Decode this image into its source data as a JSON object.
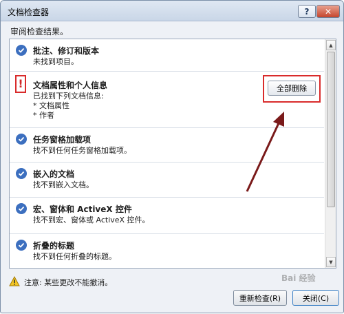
{
  "window": {
    "title": "文档检查器",
    "help_label": "?",
    "close_label": "✕"
  },
  "subtitle": "审阅检查结果。",
  "items": [
    {
      "status": "ok",
      "heading": "批注、修订和版本",
      "detail": "未找到项目。"
    },
    {
      "status": "warning",
      "heading": "文档属性和个人信息",
      "detail": "已找到下列文档信息:\n* 文档属性\n* 作者",
      "action_label": "全部删除"
    },
    {
      "status": "ok",
      "heading": "任务窗格加载项",
      "detail": "找不到任何任务窗格加载项。"
    },
    {
      "status": "ok",
      "heading": "嵌入的文档",
      "detail": "找不到嵌入文档。"
    },
    {
      "status": "ok",
      "heading": "宏、窗体和 ActiveX 控件",
      "detail": "找不到宏、窗体或 ActiveX 控件。"
    },
    {
      "status": "ok",
      "heading": "折叠的标题",
      "detail": "找不到任何折叠的标题。"
    }
  ],
  "footer": {
    "note": "注意: 某些更改不能撤消。",
    "reinspect_label": "重新检查(R)",
    "close_label": "关闭(C)"
  },
  "watermark": "Bai 经验",
  "colors": {
    "accent": "#3c6fbf",
    "highlight": "#d92b2b",
    "annotation_arrow": "#7a1a1a"
  }
}
